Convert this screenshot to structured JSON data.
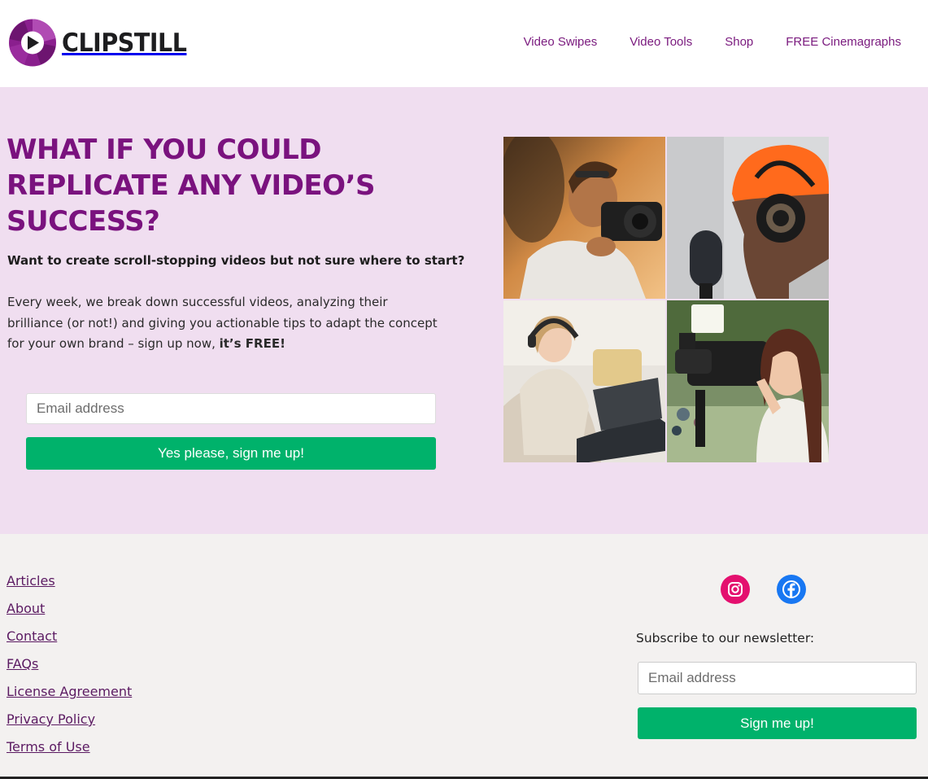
{
  "brand": {
    "name": "CLIPSTILL",
    "accent": "#7a127e",
    "green": "#00b26b"
  },
  "nav": {
    "items": [
      {
        "label": "Video Swipes"
      },
      {
        "label": "Video Tools"
      },
      {
        "label": "Shop"
      },
      {
        "label": "FREE Cinemagraphs"
      }
    ]
  },
  "hero": {
    "title": "WHAT IF YOU COULD REPLICATE ANY VIDEO’S SUCCESS?",
    "subtitle": "Want to create scroll-stopping videos but not sure where to start?",
    "body_text": "Every week, we break down successful videos, analyzing their brilliance (or not!) and giving you actionable tips to adapt the concept for your own brand – sign up now, ",
    "body_emphasis": "it’s FREE!",
    "email_placeholder": "Email address",
    "button_label": "Yes please, sign me up!"
  },
  "footer": {
    "links": [
      {
        "label": "Articles"
      },
      {
        "label": "About"
      },
      {
        "label": "Contact"
      },
      {
        "label": "FAQs"
      },
      {
        "label": "License Agreement"
      },
      {
        "label": "Privacy Policy"
      },
      {
        "label": "Terms of Use"
      }
    ],
    "social": [
      {
        "icon": "instagram-icon",
        "color": "#e1306c"
      },
      {
        "icon": "facebook-icon",
        "color": "#1877f2"
      }
    ],
    "newsletter_label": "Subscribe to our newsletter:",
    "email_placeholder": "Email address",
    "button_label": "Sign me up!"
  }
}
